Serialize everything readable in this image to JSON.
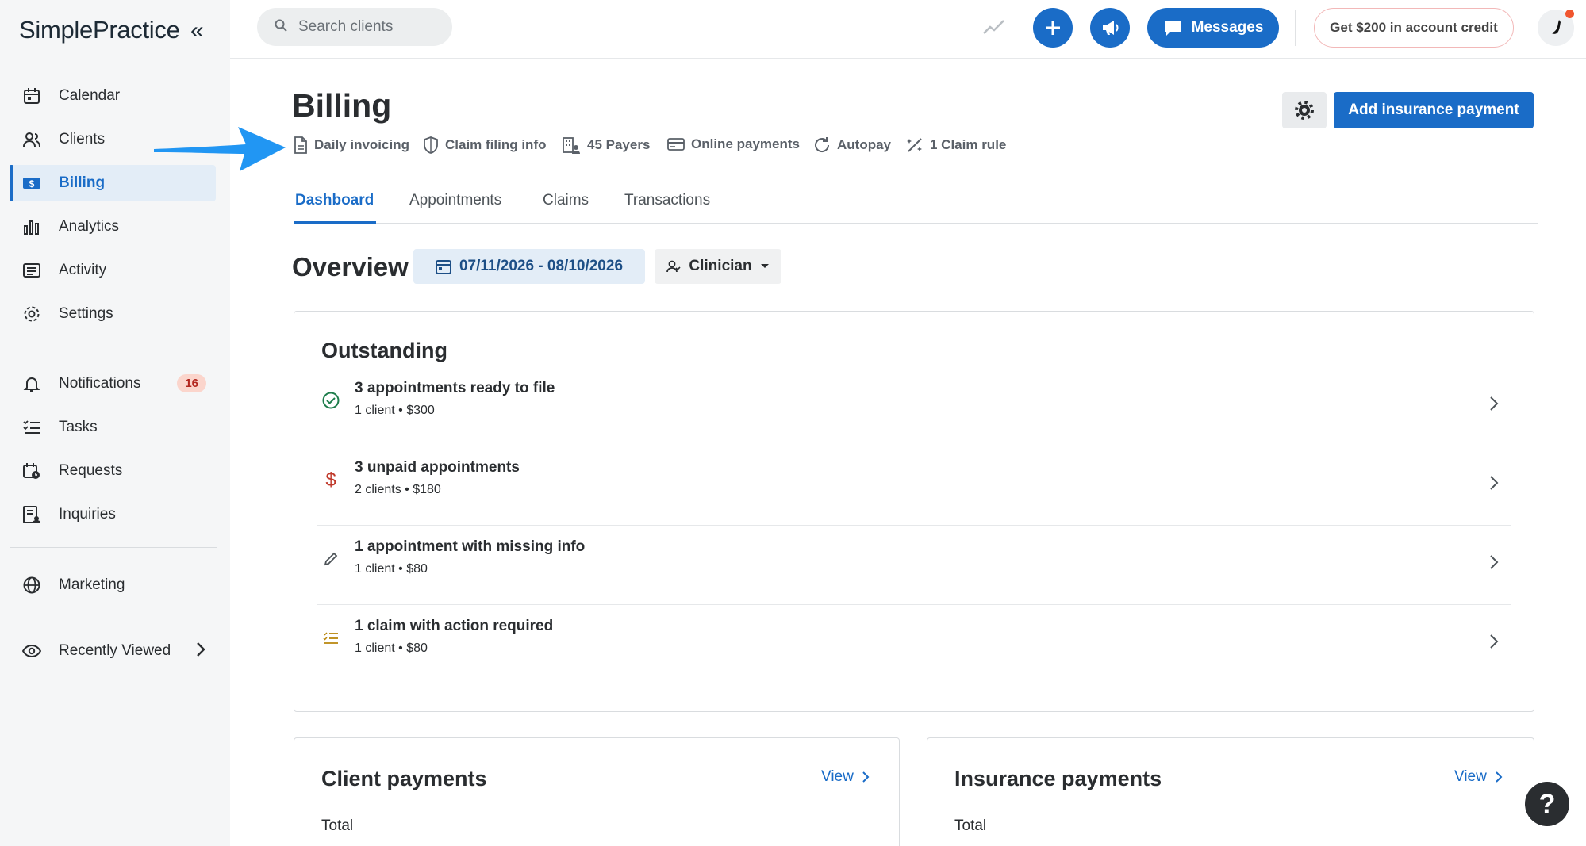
{
  "app": {
    "logo_text": "SimplePractice"
  },
  "sidebar": {
    "items": [
      {
        "label": "Calendar",
        "icon": "calendar-icon"
      },
      {
        "label": "Clients",
        "icon": "clients-icon"
      },
      {
        "label": "Billing",
        "icon": "billing-icon",
        "active": true
      },
      {
        "label": "Analytics",
        "icon": "analytics-icon"
      },
      {
        "label": "Activity",
        "icon": "activity-icon"
      },
      {
        "label": "Settings",
        "icon": "settings-icon"
      }
    ],
    "secondary": [
      {
        "label": "Notifications",
        "icon": "bell-icon",
        "badge": "16"
      },
      {
        "label": "Tasks",
        "icon": "tasks-icon"
      },
      {
        "label": "Requests",
        "icon": "requests-icon"
      },
      {
        "label": "Inquiries",
        "icon": "inquiries-icon"
      }
    ],
    "marketing": {
      "label": "Marketing",
      "icon": "globe-icon"
    },
    "recently_viewed": {
      "label": "Recently Viewed",
      "icon": "eye-icon"
    }
  },
  "topbar": {
    "search_placeholder": "Search clients",
    "messages_label": "Messages",
    "credit_label": "Get $200 in account credit"
  },
  "billing": {
    "title": "Billing",
    "quick_links": [
      {
        "label": "Daily invoicing",
        "icon": "document-icon"
      },
      {
        "label": "Claim filing info",
        "icon": "shield-icon"
      },
      {
        "label": "45 Payers",
        "icon": "building-icon"
      },
      {
        "label": "Online payments",
        "icon": "card-icon"
      },
      {
        "label": "Autopay",
        "icon": "refresh-icon"
      },
      {
        "label": "1 Claim rule",
        "icon": "wand-icon"
      }
    ],
    "add_payment_label": "Add insurance payment",
    "tabs": [
      {
        "label": "Dashboard",
        "active": true
      },
      {
        "label": "Appointments"
      },
      {
        "label": "Claims"
      },
      {
        "label": "Transactions"
      }
    ]
  },
  "overview": {
    "title": "Overview",
    "date_range": "07/11/2026 - 08/10/2026",
    "clinician_label": "Clinician"
  },
  "outstanding": {
    "title": "Outstanding",
    "rows": [
      {
        "title": "3 appointments ready to file",
        "sub": "1 client • $300",
        "icon": "check-circle-icon",
        "color": "#1e7d4c"
      },
      {
        "title": "3 unpaid appointments",
        "sub": "2 clients • $180",
        "icon": "dollar-icon",
        "color": "#c0392b"
      },
      {
        "title": "1 appointment with missing info",
        "sub": "1 client • $80",
        "icon": "pencil-icon",
        "color": "#4d5358"
      },
      {
        "title": "1 claim with action required",
        "sub": "1 client • $80",
        "icon": "checklist-icon",
        "color": "#b8860b"
      }
    ]
  },
  "client_payments": {
    "title": "Client payments",
    "view_label": "View",
    "total_label": "Total"
  },
  "insurance_payments": {
    "title": "Insurance payments",
    "view_label": "View",
    "total_label": "Total"
  },
  "help_label": "?",
  "colors": {
    "accent": "#1a6cc7",
    "sidebar_bg": "#f5f6f7",
    "badge_bg": "#fbd5cc"
  }
}
